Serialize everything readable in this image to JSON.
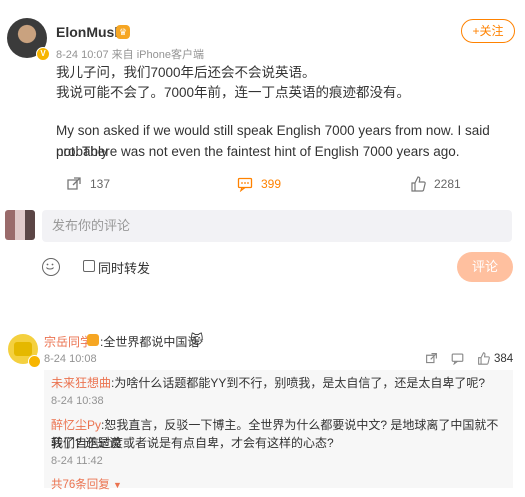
{
  "post": {
    "author": "ElonMusk",
    "meta": "8-24 10:07 来自 iPhone客户端",
    "follow_label": "+关注",
    "text_cn_1": "我儿子问，我们7000年后还会不会说英语。",
    "text_cn_2": "我说可能不会了。7000年前，连一丁点英语的痕迹都没有。",
    "text_en_1": "My son asked if we would still speak English 7000 years from now. I said probably",
    "text_en_2": "not. There was not even the faintest hint of English 7000 years ago.",
    "reposts": "137",
    "comments": "399",
    "likes": "2281"
  },
  "composer": {
    "placeholder": "发布你的评论",
    "repost_label": "同时转发",
    "submit_label": "评论"
  },
  "comment": {
    "author": "宗岳同学",
    "text": ":全世界都说中国话",
    "emoji": "🐱",
    "time": "8-24 10:08",
    "likes": "384",
    "replies": [
      {
        "name": "未来狂想曲",
        "text": ":为啥什么话题都能YY到不行，别喷我，是太自信了，还是太自卑了呢?",
        "time": "8-24 10:38"
      },
      {
        "name": "醉忆尘Py",
        "text_line1": ":恕我直言，反驳一下博主。全世界为什么都要说中文? 是地球离了中国就不转了? 还是说",
        "text_line2": "我们自信过度或者说是有点自卑，才会有这样的心态?",
        "time": "8-24 11:42"
      }
    ],
    "more_label": "共76条回复"
  },
  "colors": {
    "accent": "#ff8200",
    "name_orange": "#eb7350",
    "submit_disabled": "#ffc09f"
  }
}
